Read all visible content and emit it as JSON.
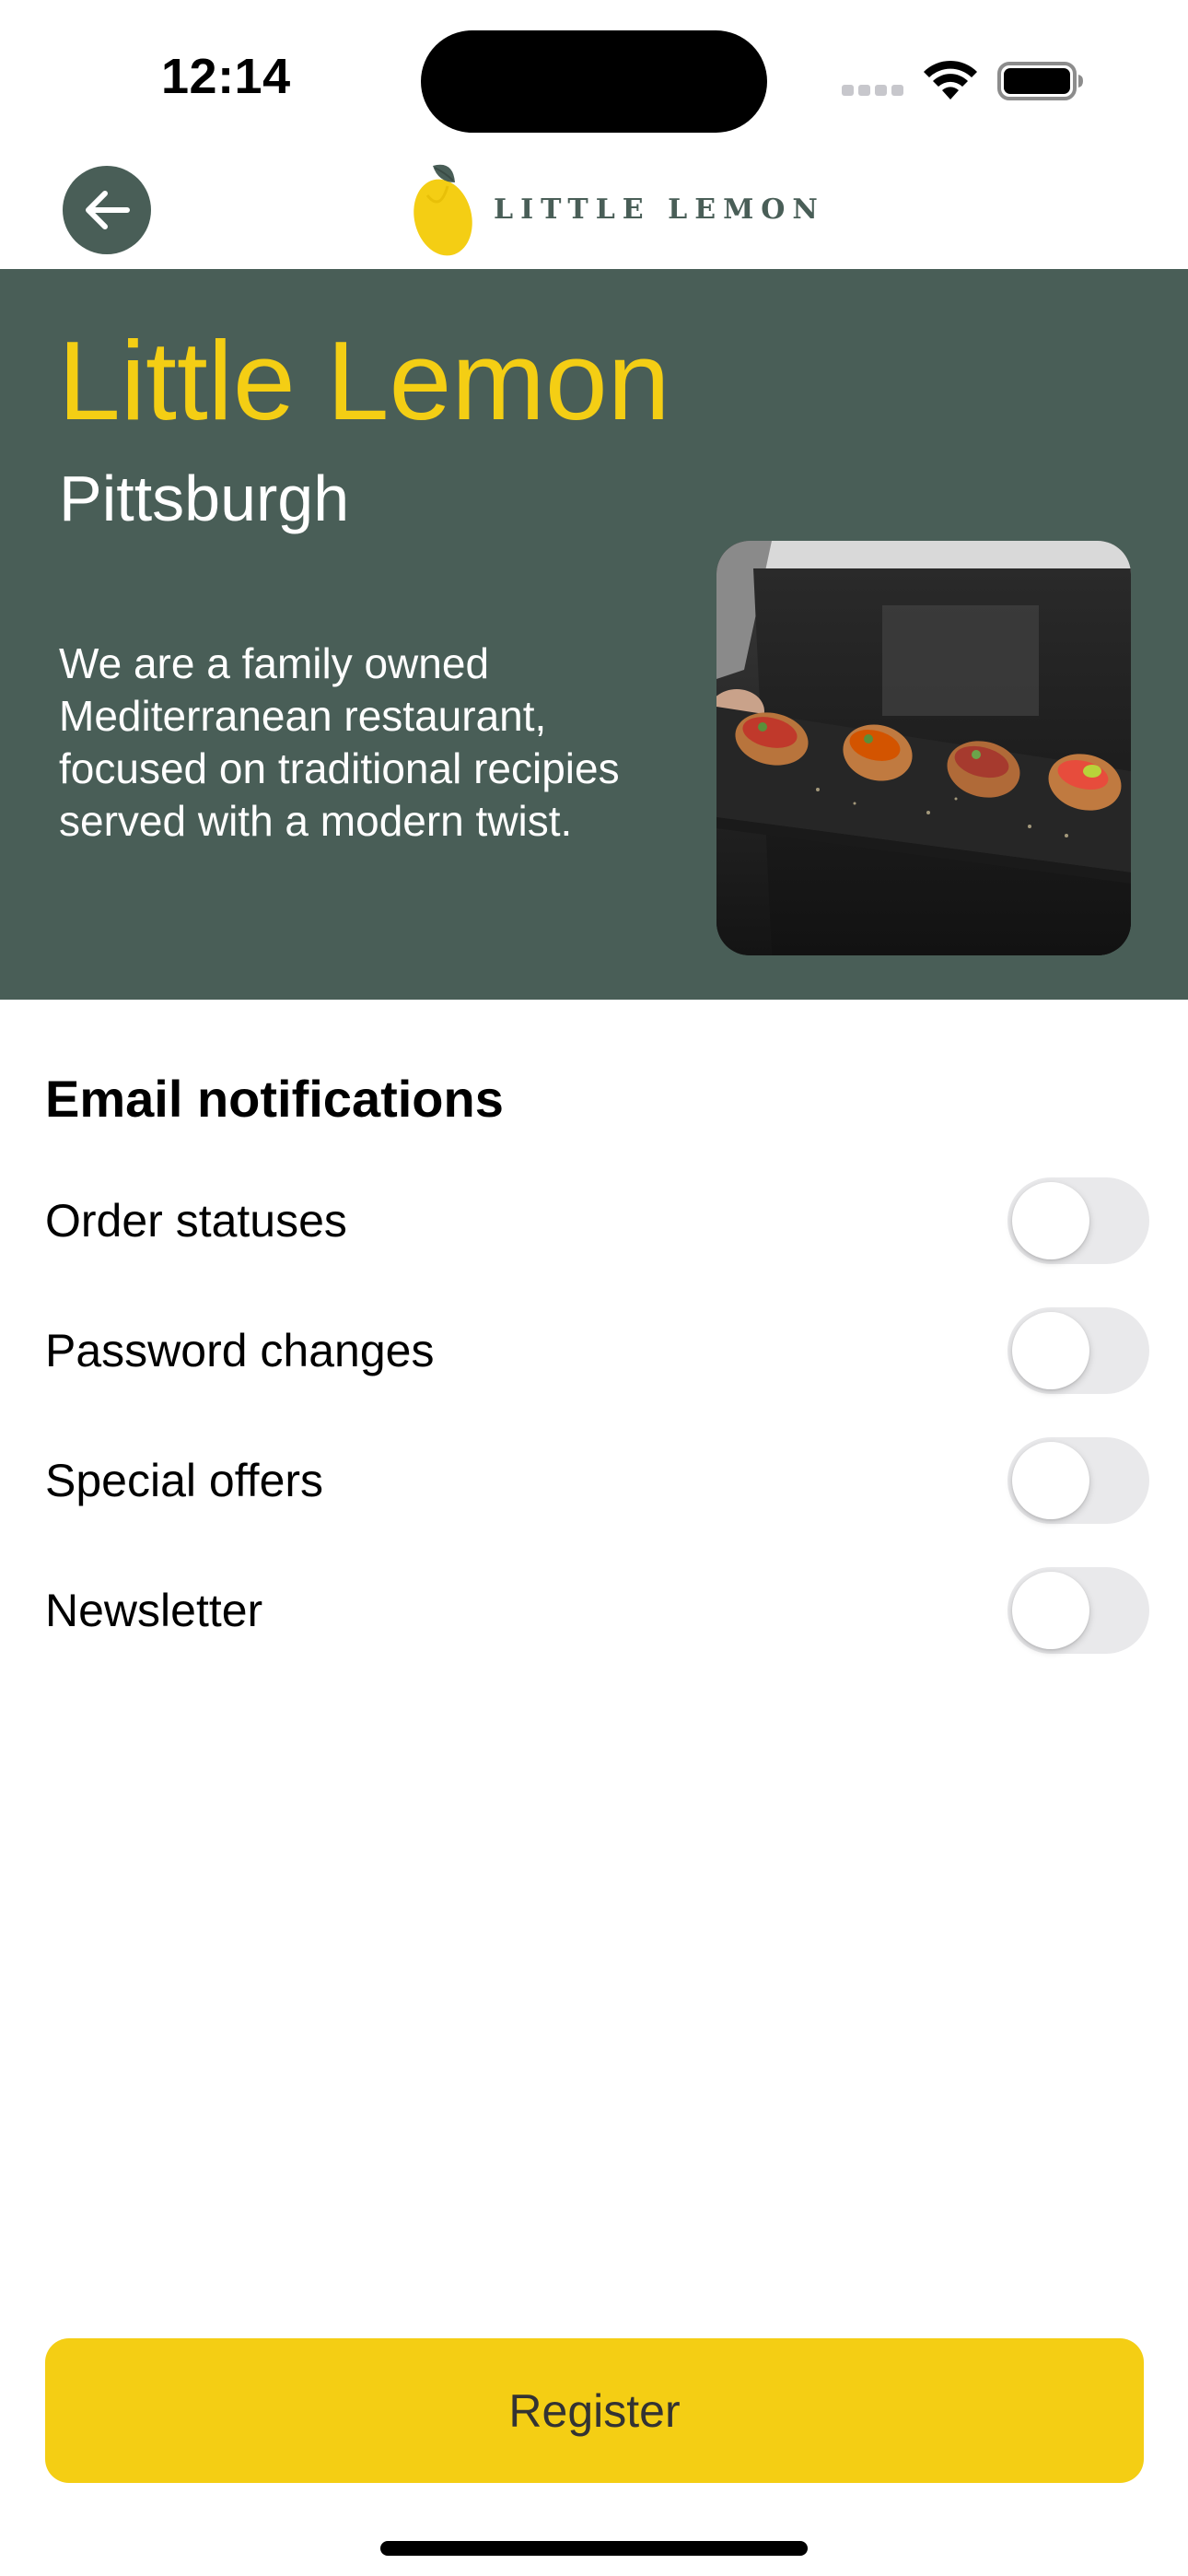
{
  "status_bar": {
    "time": "12:14",
    "icons": [
      "signal-icon",
      "wifi-icon",
      "battery-icon"
    ]
  },
  "header": {
    "back_icon": "arrow-left-icon",
    "logo_text": "LITTLE LEMON",
    "logo_icon": "lemon-icon"
  },
  "hero": {
    "title": "Little Lemon",
    "subtitle": "Pittsburgh",
    "description": "We are a family owned Mediterranean restaurant, focused on traditional recipies served with a modern twist.",
    "image_subject": "waiter holding slate tray of bruschetta"
  },
  "email_notifications": {
    "title": "Email notifications",
    "items": [
      {
        "label": "Order statuses",
        "enabled": false
      },
      {
        "label": "Password changes",
        "enabled": false
      },
      {
        "label": "Special offers",
        "enabled": false
      },
      {
        "label": "Newsletter",
        "enabled": false
      }
    ]
  },
  "register_button": {
    "label": "Register"
  },
  "colors": {
    "primary_green": "#495e57",
    "primary_yellow": "#f4ce14",
    "toggle_off": "#e9e9eb"
  }
}
